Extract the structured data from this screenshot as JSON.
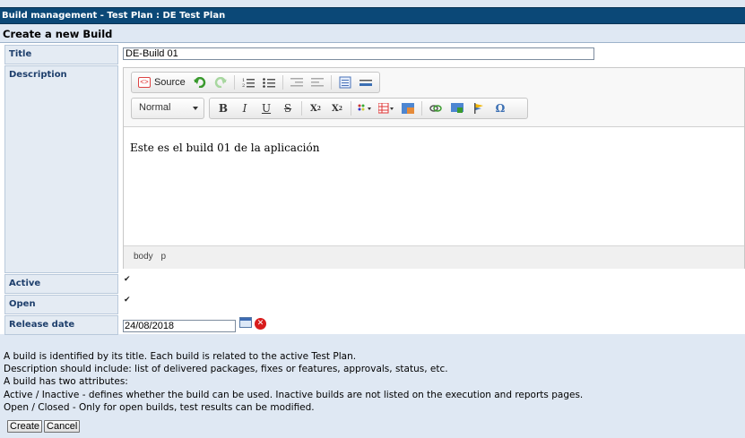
{
  "window_title": "Build management - Test Plan : DE Test Plan",
  "section_title": "Create a new Build",
  "labels": {
    "title": "Title",
    "description": "Description",
    "active": "Active",
    "open": "Open",
    "release_date": "Release date"
  },
  "fields": {
    "title_value": "DE-Build 01",
    "description_text": "Este es el build 01 de la aplicación",
    "active_checked": true,
    "open_checked": true,
    "release_date_value": "24/08/2018"
  },
  "editor": {
    "source_label": "Source",
    "format_value": "Normal",
    "path": [
      "body",
      "p"
    ],
    "toolbar_row1_icons": [
      "source-icon",
      "undo-icon",
      "redo-icon",
      "numbered-list-icon",
      "bulleted-list-icon",
      "outdent-icon",
      "indent-icon",
      "table-icon",
      "horizontal-rule-icon"
    ],
    "toolbar_row2_icons": [
      "bold-icon",
      "italic-icon",
      "underline-icon",
      "strikethrough-icon",
      "subscript-icon",
      "superscript-icon",
      "text-color-icon",
      "table-insert-icon",
      "image-icon",
      "link-icon",
      "insert-image-icon",
      "flag-icon",
      "special-char-icon"
    ]
  },
  "help_lines": [
    "A build is identified by its title. Each build is related to the active Test Plan.",
    "Description should include: list of delivered packages, fixes or features, approvals, status, etc.",
    "A build has two attributes:",
    "Active / Inactive - defines whether the build can be used. Inactive builds are not listed on the execution and reports pages.",
    "Open / Closed - Only for open builds, test results can be modified."
  ],
  "buttons": {
    "create": "Create",
    "cancel": "Cancel"
  },
  "colors": {
    "title_bar": "#0b4877",
    "label_text": "#1e3f6c",
    "panel_bg": "#dfe8f3"
  }
}
